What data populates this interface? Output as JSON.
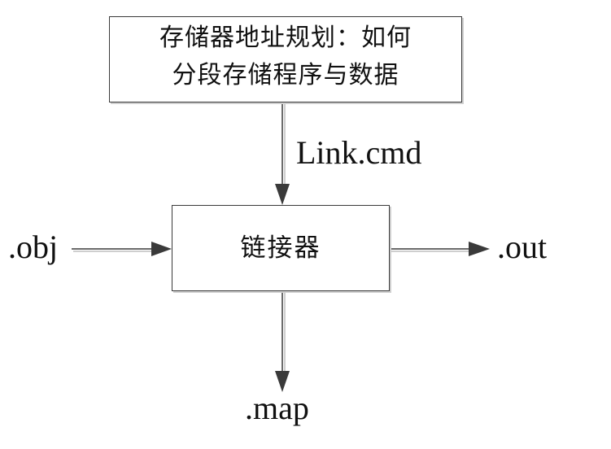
{
  "diagram": {
    "planning_box": {
      "line1": "存储器地址规划：如何",
      "line2": "分段存储程序与数据"
    },
    "linker_box": {
      "label": "链接器"
    },
    "inputs": {
      "command_file": "Link.cmd",
      "object_file": ".obj"
    },
    "outputs": {
      "executable_file": ".out",
      "map_file": ".map"
    },
    "colors": {
      "stroke": "#3a3a3a",
      "arrow_shadow": "#cfcfcf",
      "background": "#ffffff"
    }
  }
}
